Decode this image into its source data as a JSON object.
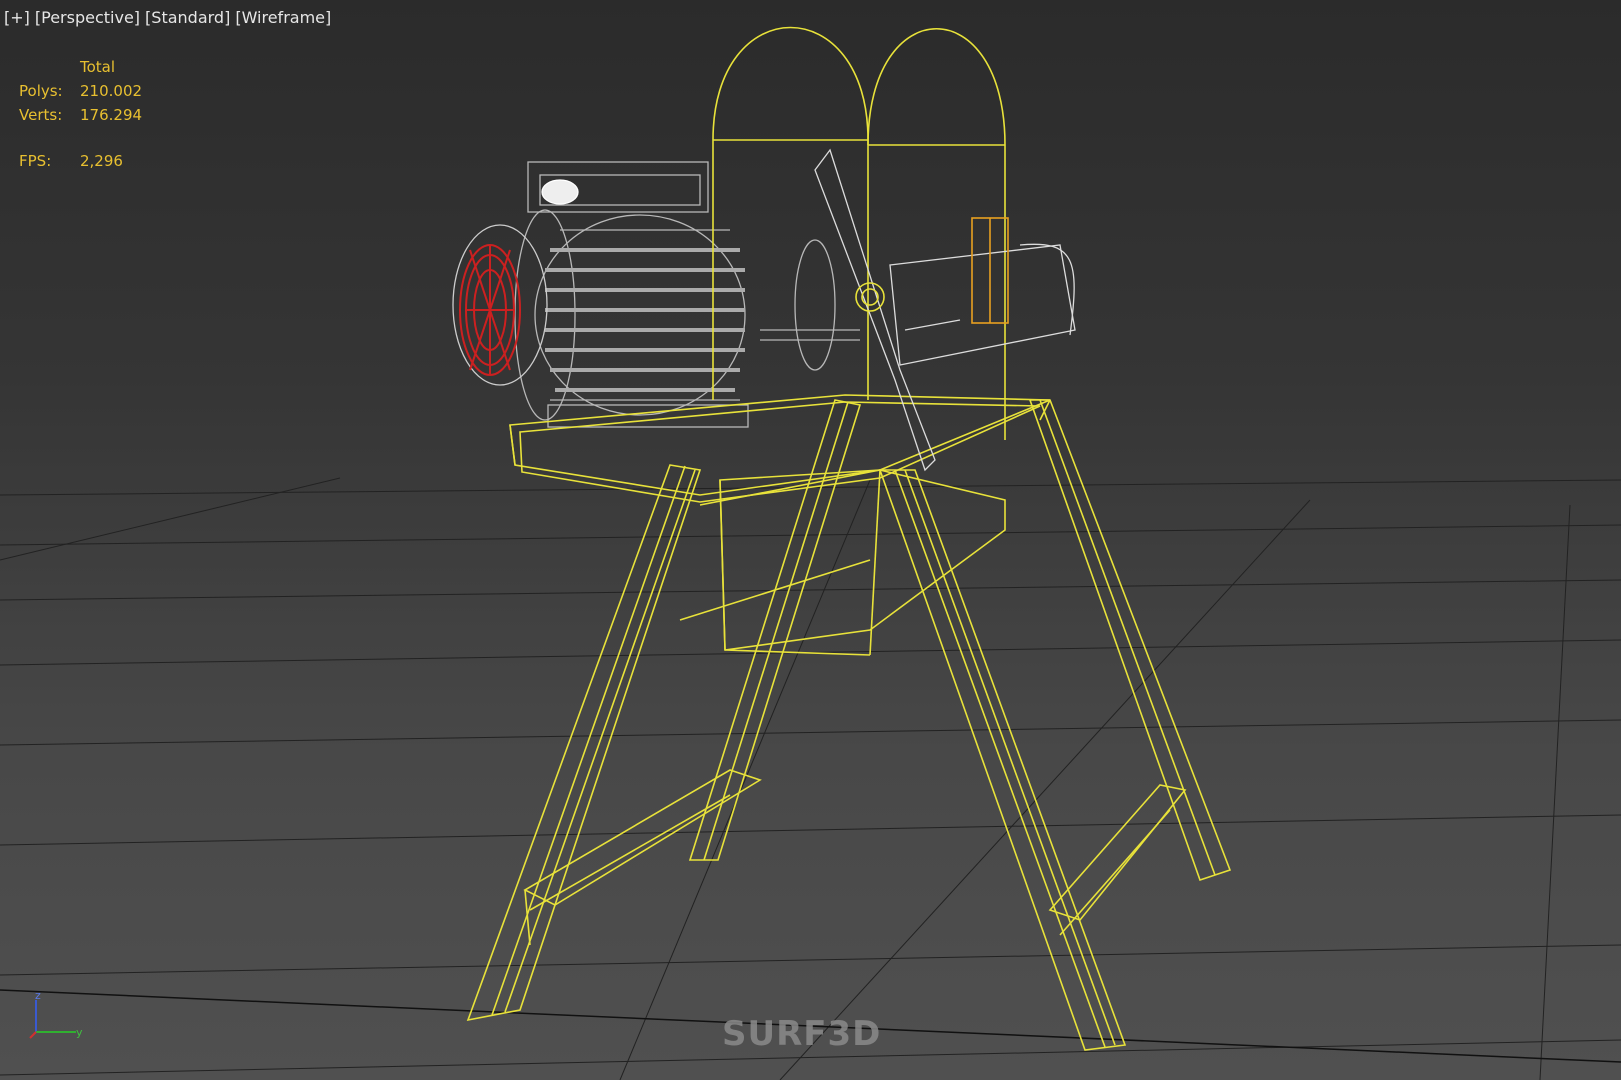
{
  "viewport": {
    "labels": [
      "[+]",
      "[Perspective]",
      "[Standard]",
      "[Wireframe]"
    ]
  },
  "stats": {
    "header": "Total",
    "polys_label": "Polys:",
    "polys_value": "210.002",
    "verts_label": "Verts:",
    "verts_value": "176.294",
    "fps_label": "FPS:",
    "fps_value": "2,296"
  },
  "axis_gizmo": {
    "z_label": "z",
    "y_label": "y"
  },
  "watermark": "SURF3D",
  "colors": {
    "wireframe_selected": "#e8e23a",
    "wireframe_motor": "#b8b8b8",
    "fan_red": "#cc2020",
    "grid": "#1e1e1e",
    "stats_text": "#e8c030"
  }
}
